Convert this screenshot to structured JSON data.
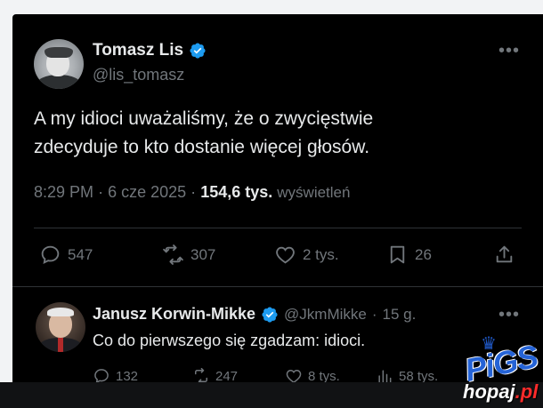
{
  "main_tweet": {
    "display_name": "Tomasz Lis",
    "handle": "@lis_tomasz",
    "text_line1": "A my idioci uważaliśmy, że o zwycięstwie",
    "text_line2": "zdecyduje to kto dostanie więcej głosów.",
    "time": "8:29 PM",
    "dot": "·",
    "date": "6 cze 2025",
    "views_count": "154,6 tys.",
    "views_label": "wyświetleń",
    "more_icon": "•••",
    "actions": {
      "replies": "547",
      "reposts": "307",
      "likes": "2 tys.",
      "bookmarks": "26"
    }
  },
  "reply": {
    "display_name": "Janusz Korwin-Mikke",
    "handle": "@JkmMikke",
    "dot": "·",
    "time": "15 g.",
    "text": "Co do pierwszego się zgadzam: idioci.",
    "more_icon": "•••",
    "actions": {
      "replies": "132",
      "reposts": "247",
      "likes": "8 tys.",
      "views": "58 tys."
    }
  },
  "watermark": {
    "crown_icon": "♛",
    "pigs": "PiGS",
    "logo_main": "hopaj",
    "logo_suffix": ".pl"
  },
  "colors": {
    "background": "#000000",
    "text_primary": "#e7e9ea",
    "text_secondary": "#71767b",
    "verified_blue": "#1d9bf0",
    "divider": "#2f3336"
  }
}
